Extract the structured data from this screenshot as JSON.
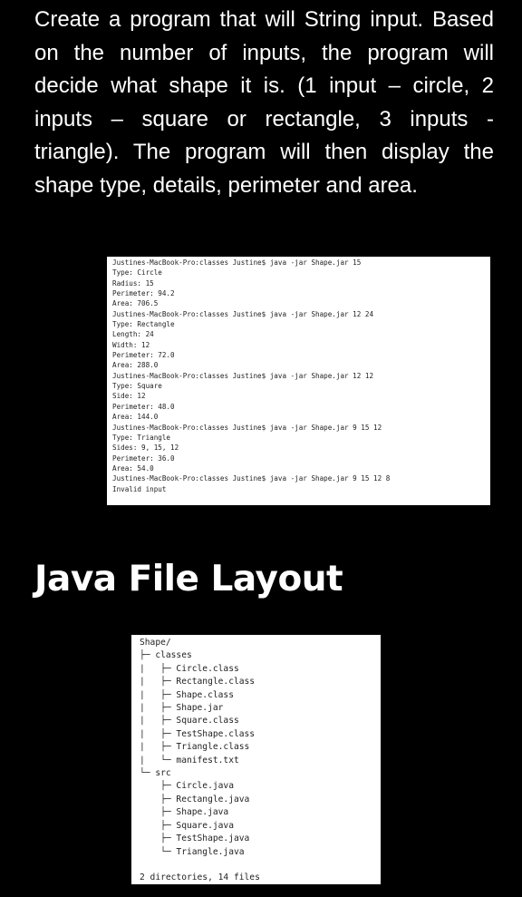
{
  "intro": "Create a program that will String input. Based on the number of inputs, the program will decide what shape it is. (1 input – circle, 2 inputs – square or rectangle, 3 inputs - triangle). The program will then display the shape type, details, perimeter and area.",
  "terminal_lines": [
    "Justines-MacBook-Pro:classes Justine$ java -jar Shape.jar 15",
    "Type: Circle",
    "Radius: 15",
    "Perimeter: 94.2",
    "Area: 706.5",
    "Justines-MacBook-Pro:classes Justine$ java -jar Shape.jar 12 24",
    "Type: Rectangle",
    "Length: 24",
    "Width: 12",
    "Perimeter: 72.0",
    "Area: 288.0",
    "Justines-MacBook-Pro:classes Justine$ java -jar Shape.jar 12 12",
    "Type: Square",
    "Side: 12",
    "Perimeter: 48.0",
    "Area: 144.0",
    "Justines-MacBook-Pro:classes Justine$ java -jar Shape.jar 9 15 12",
    "Type: Triangle",
    "Sides: 9, 15, 12",
    "Perimeter: 36.0",
    "Area: 54.0",
    "Justines-MacBook-Pro:classes Justine$ java -jar Shape.jar 9 15 12 8",
    "Invalid input"
  ],
  "heading": "Java File Layout",
  "tree_lines": [
    "Shape/",
    "├─ classes",
    "|   ├─ Circle.class",
    "|   ├─ Rectangle.class",
    "|   ├─ Shape.class",
    "|   ├─ Shape.jar",
    "|   ├─ Square.class",
    "|   ├─ TestShape.class",
    "|   ├─ Triangle.class",
    "|   └─ manifest.txt",
    "└─ src",
    "    ├─ Circle.java",
    "    ├─ Rectangle.java",
    "    ├─ Shape.java",
    "    ├─ Square.java",
    "    ├─ TestShape.java",
    "    └─ Triangle.java",
    "",
    "2 directories, 14 files"
  ]
}
